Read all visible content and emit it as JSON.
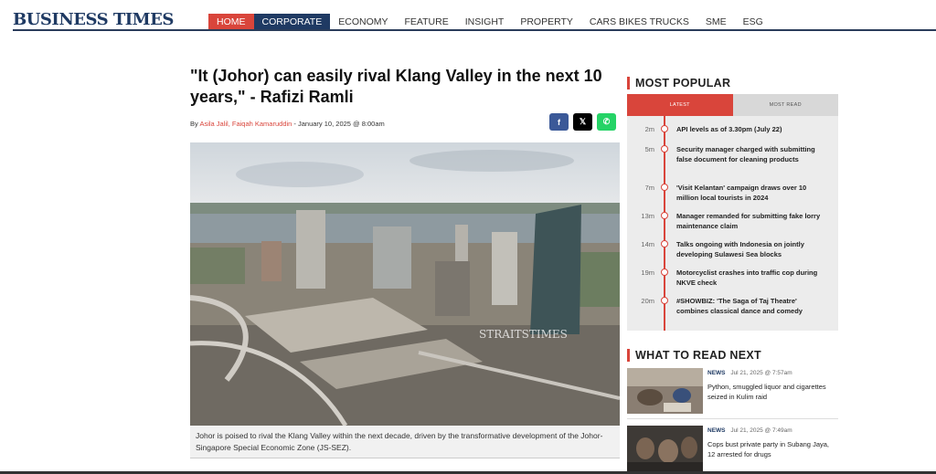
{
  "header": {
    "logo": "BUSINESS TIMES",
    "nav": [
      "HOME",
      "CORPORATE",
      "ECONOMY",
      "FEATURE",
      "INSIGHT",
      "PROPERTY",
      "CARS BIKES TRUCKS",
      "SME",
      "ESG"
    ]
  },
  "article": {
    "headline": "\"It (Johor) can easily rival Klang Valley in the next 10 years,\" - Rafizi Ramli",
    "by": "By ",
    "authors": "Asila Jalil, Faiqah Kamaruddin",
    "date": " - January 10, 2025 @ 8:00am",
    "share": [
      "f",
      "𝕏",
      "✆"
    ],
    "watermark": "STRAITSTIMES",
    "caption": "Johor is poised to rival the Klang Valley within the next decade, driven by the transformative development of the Johor-Singapore Special Economic Zone (JS-SEZ)."
  },
  "sidebar": {
    "most_popular_title": "MOST POPULAR",
    "tabs": [
      "LATEST",
      "MOST READ"
    ],
    "popular": [
      {
        "time": "2m",
        "title": "API levels as of 3.30pm (July 22)"
      },
      {
        "time": "5m",
        "title": "Security manager charged with submitting false document for cleaning products"
      },
      {
        "time": "7m",
        "title": "'Visit Kelantan' campaign draws over 10 million local tourists in 2024"
      },
      {
        "time": "13m",
        "title": "Manager remanded for submitting fake lorry maintenance claim"
      },
      {
        "time": "14m",
        "title": "Talks ongoing with Indonesia on jointly developing Sulawesi Sea blocks"
      },
      {
        "time": "19m",
        "title": "Motorcyclist crashes into traffic cop during NKVE check"
      },
      {
        "time": "20m",
        "title": "#SHOWBIZ: 'The Saga of Taj Theatre' combines classical dance and comedy"
      }
    ],
    "what_to_read_title": "WHAT TO READ NEXT",
    "read_next": [
      {
        "tag": "NEWS",
        "date": "Jul 21, 2025 @ 7:57am",
        "title": "Python, smuggled liquor and cigarettes seized in Kulim raid"
      },
      {
        "tag": "NEWS",
        "date": "Jul 21, 2025 @ 7:49am",
        "title": "Cops bust private party in Subang Jaya, 12 arrested for drugs"
      }
    ]
  },
  "colors": {
    "accent": "#d9453b",
    "brand": "#1f3a63"
  }
}
